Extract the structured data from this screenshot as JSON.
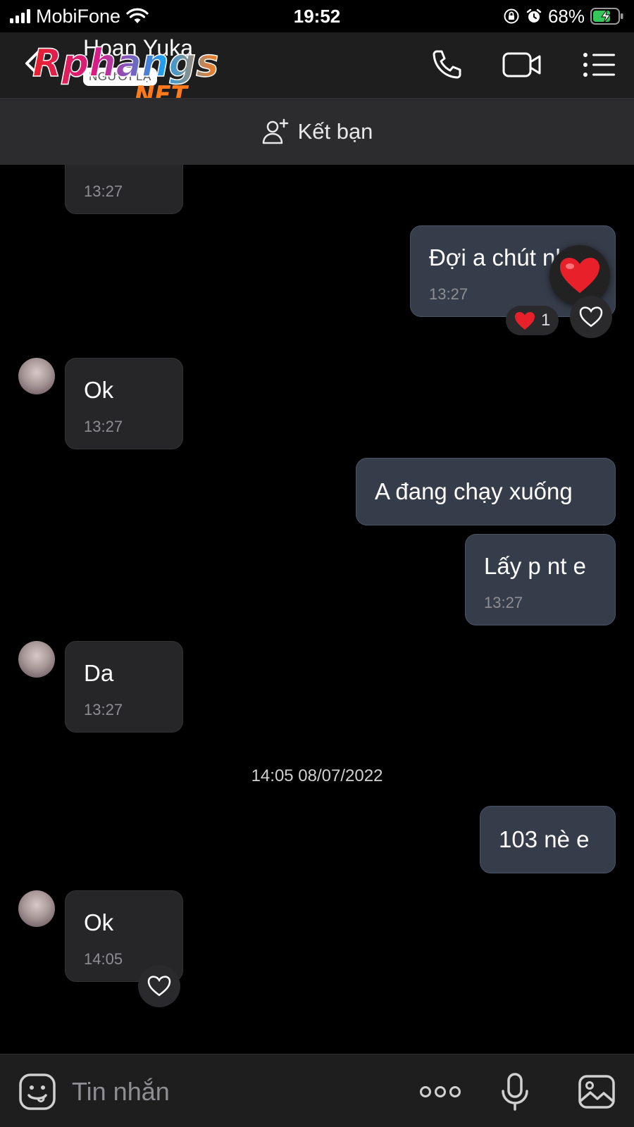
{
  "status_bar": {
    "carrier": "MobiFone",
    "time": "19:52",
    "battery": "68%"
  },
  "header": {
    "contact_name": "Hoan Yuka",
    "badge": "NGƯỜI LẠ",
    "watermark": {
      "brand": "Rphangs",
      "suffix": ".NET"
    }
  },
  "friend_bar": {
    "label": "Kết bạn"
  },
  "messages": [
    {
      "from": "contact",
      "text": "Ok",
      "time": "13:27"
    },
    {
      "from": "me",
      "text": "Đợi a chút nhé",
      "time": "13:27",
      "reaction": {
        "icon": "heart-icon",
        "count": "1"
      }
    },
    {
      "from": "contact",
      "text": "Ok",
      "time": "13:27"
    },
    {
      "from": "me",
      "text": "A đang chạy xuống",
      "time": ""
    },
    {
      "from": "me",
      "text": "Lấy p nt e",
      "time": "13:27"
    },
    {
      "from": "contact",
      "text": "Da",
      "time": "13:27"
    },
    {
      "from": "me",
      "text": "103 nè e",
      "time": ""
    },
    {
      "from": "contact",
      "text": "Ok",
      "time": "14:05"
    }
  ],
  "date_separator": "14:05 08/07/2022",
  "input": {
    "placeholder": "Tin nhắn"
  },
  "colors": {
    "background": "#000000",
    "incoming_bubble": "#262628",
    "outgoing_bubble": "#363d4a",
    "outgoing_border": "#4a5366",
    "heart": "#e8202a"
  }
}
